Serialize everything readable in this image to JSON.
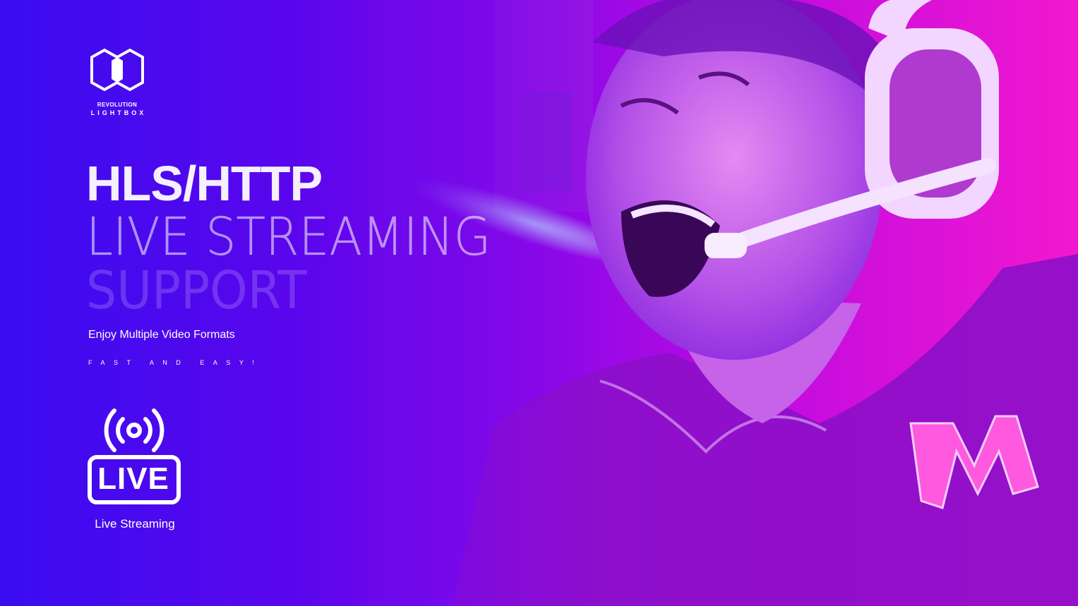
{
  "brand": {
    "line1": "REVOLUTION",
    "line2": "LIGHTBOX",
    "logo_icon": "hexagon-logo-icon"
  },
  "headline": {
    "line1": "HLS/HTTP",
    "line2": "LIVE STREAMING",
    "line3": "SUPPORT"
  },
  "subtitle": "Enjoy Multiple Video Formats",
  "tagline": "FAST AND EASY!",
  "feature": {
    "icon": "live-broadcast-icon",
    "badge_text": "LIVE",
    "label": "Live Streaming"
  },
  "colors": {
    "gradient_left": "#3a0cf0",
    "gradient_mid": "#8a08e8",
    "gradient_right": "#f218cf",
    "text": "#ffffff"
  }
}
